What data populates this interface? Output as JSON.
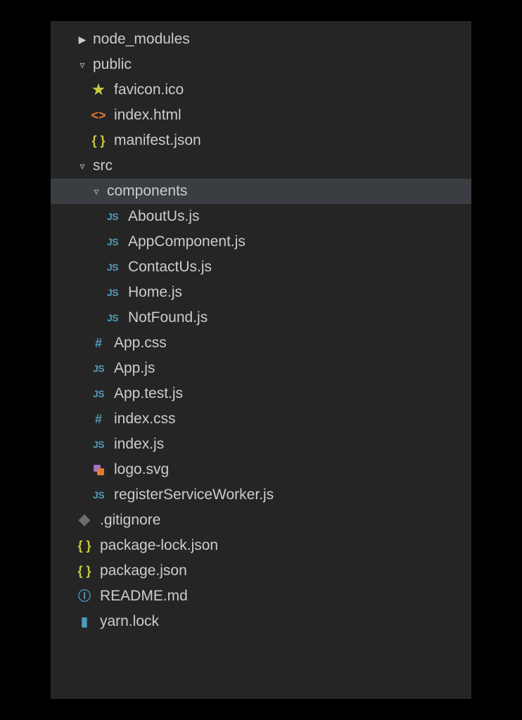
{
  "tree": {
    "node_modules": {
      "label": "node_modules"
    },
    "public": {
      "label": "public",
      "favicon": {
        "label": "favicon.ico",
        "icon_text": "★"
      },
      "index_html": {
        "label": "index.html",
        "icon_text": "<>"
      },
      "manifest": {
        "label": "manifest.json",
        "icon_text": "{ }"
      }
    },
    "src": {
      "label": "src",
      "components": {
        "label": "components",
        "about": {
          "label": "AboutUs.js",
          "icon_text": "JS"
        },
        "appcomp": {
          "label": "AppComponent.js",
          "icon_text": "JS"
        },
        "contact": {
          "label": "ContactUs.js",
          "icon_text": "JS"
        },
        "home": {
          "label": "Home.js",
          "icon_text": "JS"
        },
        "notfound": {
          "label": "NotFound.js",
          "icon_text": "JS"
        }
      },
      "app_css": {
        "label": "App.css",
        "icon_text": "#"
      },
      "app_js": {
        "label": "App.js",
        "icon_text": "JS"
      },
      "app_test": {
        "label": "App.test.js",
        "icon_text": "JS"
      },
      "index_css": {
        "label": "index.css",
        "icon_text": "#"
      },
      "index_js": {
        "label": "index.js",
        "icon_text": "JS"
      },
      "logo_svg": {
        "label": "logo.svg"
      },
      "rsw": {
        "label": "registerServiceWorker.js",
        "icon_text": "JS"
      }
    },
    "gitignore": {
      "label": ".gitignore"
    },
    "pkg_lock": {
      "label": "package-lock.json",
      "icon_text": "{ }"
    },
    "pkg": {
      "label": "package.json",
      "icon_text": "{ }"
    },
    "readme": {
      "label": "README.md",
      "icon_text": "ⓘ"
    },
    "yarn": {
      "label": "yarn.lock",
      "icon_text": "▮"
    }
  },
  "chevron": {
    "collapsed": "▶",
    "expanded": "▿"
  }
}
